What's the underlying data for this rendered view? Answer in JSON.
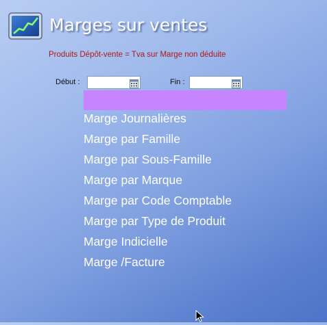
{
  "header": {
    "title": "Marges sur ventes",
    "logo_icon": "line-chart-icon"
  },
  "notice": "Produits Dépôt-vente = Tva sur Marge non déduite",
  "filters": {
    "debut_label": "Début :",
    "debut_value": "",
    "fin_label": "Fin :",
    "fin_value": "",
    "calendar_icon": "calendar-icon"
  },
  "menu": {
    "items": [
      "Marge Journalières",
      "Marge par Famille",
      "Marge par Sous-Famille",
      "Marge par Marque",
      "Marge par Code Comptable",
      "Marge par Type de Produit",
      "Marge Indicielle",
      "Marge /Facture"
    ]
  },
  "colors": {
    "notice": "#b01818",
    "highlight": "#c685ff",
    "menu_text": "#ffffff",
    "background_top": "#b9cdf3",
    "background_bottom": "#4e74c8"
  }
}
